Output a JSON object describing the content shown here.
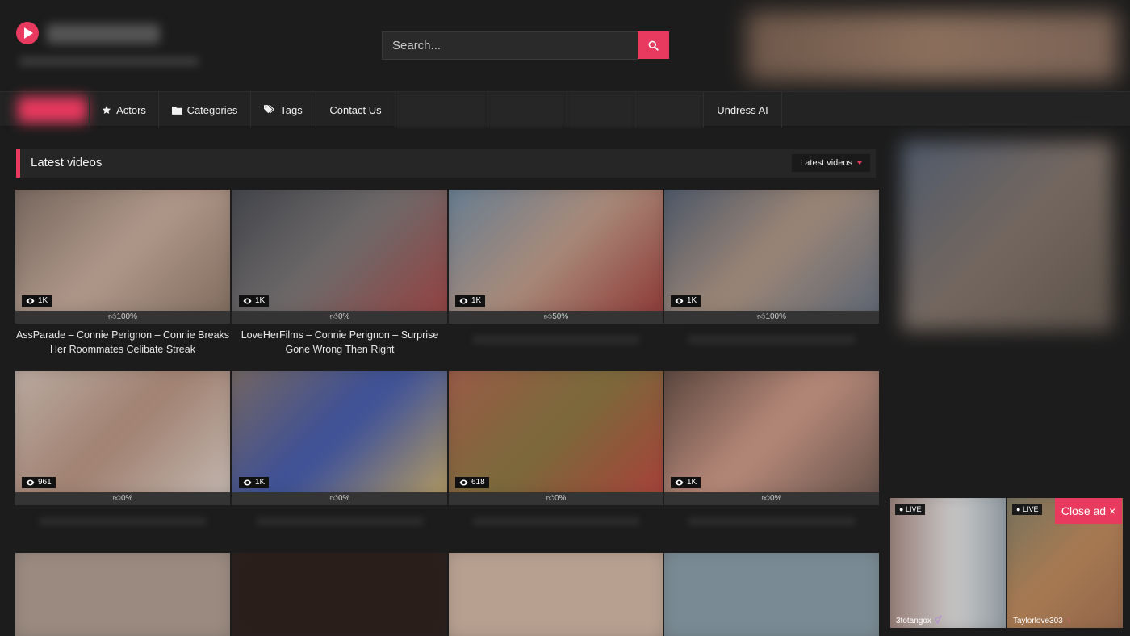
{
  "header": {
    "search_placeholder": "Search...",
    "search_icon": "search-icon"
  },
  "nav": {
    "items": [
      {
        "label": "Actors",
        "icon": "star-icon"
      },
      {
        "label": "Categories",
        "icon": "folder-icon"
      },
      {
        "label": "Tags",
        "icon": "tags-icon"
      },
      {
        "label": "Contact Us",
        "icon": ""
      },
      {
        "label": "Undress AI",
        "icon": ""
      }
    ]
  },
  "section": {
    "title": "Latest videos",
    "sort_label": "Latest videos"
  },
  "videos": [
    {
      "views": "1K",
      "rating": "100%",
      "title": "AssParade – Connie Perignon – Connie Breaks Her Roommates Celibate Streak"
    },
    {
      "views": "1K",
      "rating": "0%",
      "title": "LoveHerFilms – Connie Perignon – Surprise Gone Wrong Then Right"
    },
    {
      "views": "1K",
      "rating": "50%",
      "title": ""
    },
    {
      "views": "1K",
      "rating": "100%",
      "title": ""
    },
    {
      "views": "961",
      "rating": "0%",
      "title": ""
    },
    {
      "views": "1K",
      "rating": "0%",
      "title": ""
    },
    {
      "views": "618",
      "rating": "0%",
      "title": ""
    },
    {
      "views": "1K",
      "rating": "0%",
      "title": ""
    }
  ],
  "live": {
    "badge": "LIVE",
    "users": [
      {
        "name": "3totangox",
        "icon": "gender-male-female-icon"
      },
      {
        "name": "Taylorlove303",
        "icon": "gender-female-icon"
      }
    ],
    "close_label": "Close ad ×"
  },
  "colors": {
    "accent": "#e8395f",
    "background": "#1c1c1c",
    "panel": "#262626"
  }
}
